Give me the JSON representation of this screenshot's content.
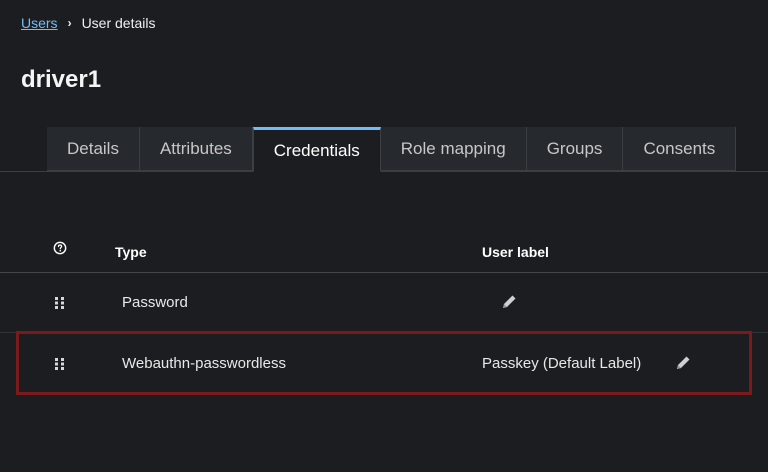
{
  "breadcrumb": {
    "parent": "Users",
    "separator": "›",
    "current": "User details"
  },
  "page": {
    "title": "driver1"
  },
  "tabs": [
    {
      "label": "Details",
      "active": false
    },
    {
      "label": "Attributes",
      "active": false
    },
    {
      "label": "Credentials",
      "active": true
    },
    {
      "label": "Role mapping",
      "active": false
    },
    {
      "label": "Groups",
      "active": false
    },
    {
      "label": "Consents",
      "active": false
    }
  ],
  "table": {
    "headers": {
      "help_icon": "help-circle-icon",
      "type": "Type",
      "user_label": "User label"
    },
    "rows": [
      {
        "type": "Password",
        "user_label": ""
      },
      {
        "type": "Webauthn-passwordless",
        "user_label": "Passkey (Default Label)"
      }
    ]
  },
  "colors": {
    "background": "#1b1d21",
    "link": "#73bcf7",
    "active_tab_border": "#73bcf7",
    "highlight_box": "#7a1a1a"
  },
  "icons": {
    "drag": "grip-vertical-icon",
    "edit": "pencil-icon",
    "help": "help-circle-icon"
  }
}
